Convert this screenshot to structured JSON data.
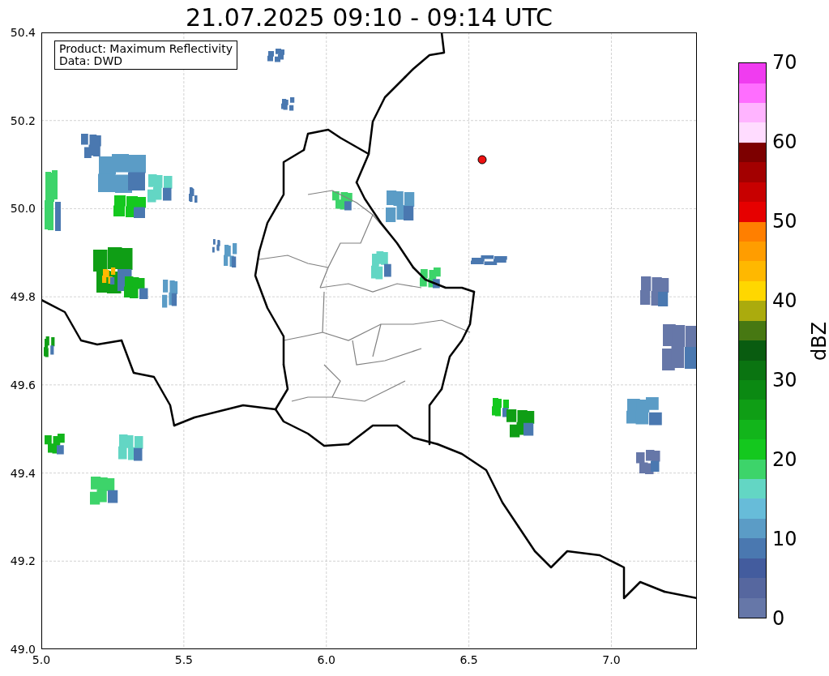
{
  "title": "21.07.2025 09:10 - 09:14 UTC",
  "map": {
    "info": [
      "Product: Maximum Reflectivity",
      "Data: DWD"
    ],
    "xticks": [
      "5.0",
      "5.5",
      "6.0",
      "6.5",
      "7.0"
    ],
    "yticks": [
      "50.4",
      "50.2",
      "50.0",
      "49.8",
      "49.6",
      "49.4",
      "49.2",
      "49.0"
    ]
  },
  "colorbar": {
    "label": "dBZ",
    "ticks": [
      "70",
      "60",
      "50",
      "40",
      "30",
      "20",
      "10",
      "0"
    ],
    "segments": [
      {
        "color": "#6677a8"
      },
      {
        "color": "#56679f"
      },
      {
        "color": "#435c9e"
      },
      {
        "color": "#4a78b0"
      },
      {
        "color": "#5b9cc6"
      },
      {
        "color": "#67bcd9"
      },
      {
        "color": "#63d6c4"
      },
      {
        "color": "#3dd46a"
      },
      {
        "color": "#14c81e"
      },
      {
        "color": "#12b51b"
      },
      {
        "color": "#0f9e15"
      },
      {
        "color": "#0b8912"
      },
      {
        "color": "#0a7411"
      },
      {
        "color": "#095c10"
      },
      {
        "color": "#477812"
      },
      {
        "color": "#abab0d"
      },
      {
        "color": "#ffd700"
      },
      {
        "color": "#ffb800"
      },
      {
        "color": "#ff9d00"
      },
      {
        "color": "#ff7f00"
      },
      {
        "color": "#e60000"
      },
      {
        "color": "#c80000"
      },
      {
        "color": "#a30000"
      },
      {
        "color": "#7d0000"
      },
      {
        "color": "#ffdcff"
      },
      {
        "color": "#ffb4ff"
      },
      {
        "color": "#ff6eff"
      },
      {
        "color": "#f03cf0"
      }
    ]
  }
}
